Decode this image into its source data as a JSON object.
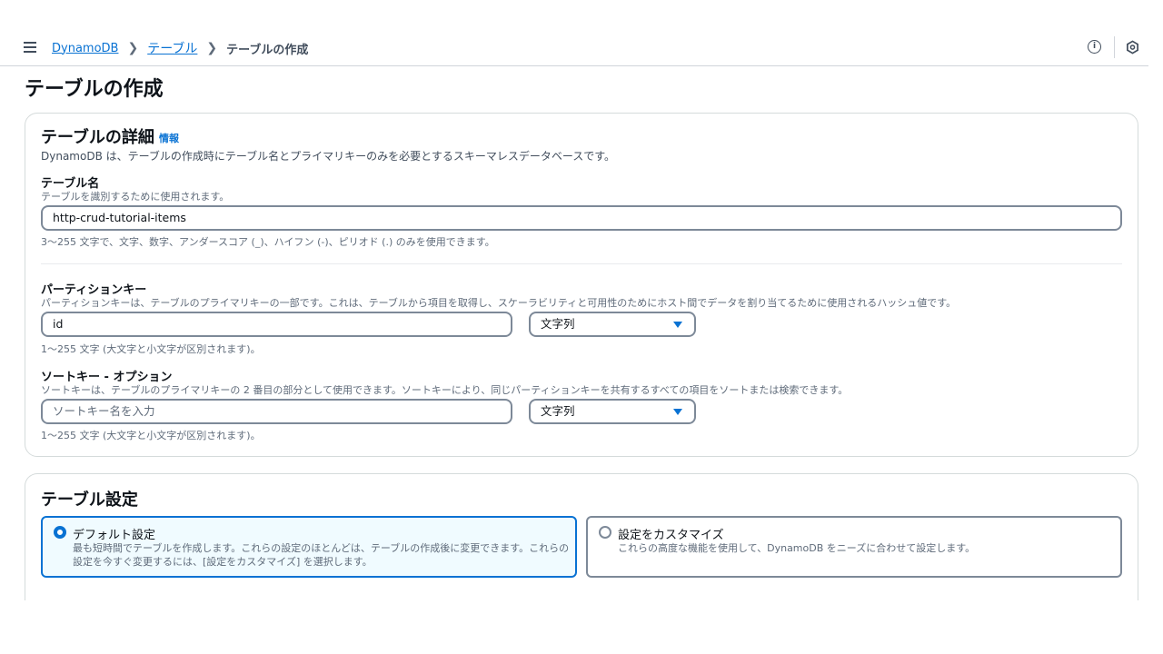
{
  "breadcrumb": {
    "items": [
      "DynamoDB",
      "テーブル"
    ],
    "current": "テーブルの作成"
  },
  "page": {
    "title": "テーブルの作成"
  },
  "details": {
    "title": "テーブルの詳細",
    "info": "情報",
    "description": "DynamoDB は、テーブルの作成時にテーブル名とプライマリキーのみを必要とするスキーマレスデータベースです。",
    "table_name": {
      "label": "テーブル名",
      "description": "テーブルを識別するために使用されます。",
      "value": "http-crud-tutorial-items",
      "constraint": "3～255 文字で、文字、数字、アンダースコア (_)、ハイフン (-)、ピリオド (.) のみを使用できます。"
    },
    "partition_key": {
      "label": "パーティションキー",
      "description": "パーティションキーは、テーブルのプライマリキーの一部です。これは、テーブルから項目を取得し、スケーラビリティと可用性のためにホスト間でデータを割り当てるために使用されるハッシュ値です。",
      "value": "id",
      "type": "文字列",
      "constraint": "1～255 文字 (大文字と小文字が区別されます)。"
    },
    "sort_key": {
      "label": "ソートキー - オプション",
      "description": "ソートキーは、テーブルのプライマリキーの 2 番目の部分として使用できます。ソートキーにより、同じパーティションキーを共有するすべての項目をソートまたは検索できます。",
      "placeholder": "ソートキー名を入力",
      "type": "文字列",
      "constraint": "1～255 文字 (大文字と小文字が区別されます)。"
    }
  },
  "settings": {
    "title": "テーブル設定",
    "options": [
      {
        "title": "デフォルト設定",
        "description_line1": "最も短時間でテーブルを作成します。これらの設定のほとんどは、テーブルの作成後に変更できます。これらの",
        "description_line2": "設定を今すぐ変更するには、[設定をカスタマイズ] を選択します。",
        "selected": true
      },
      {
        "title": "設定をカスタマイズ",
        "description_line1": "これらの高度な機能を使用して、DynamoDB をニーズに合わせて設定します。",
        "selected": false
      }
    ]
  },
  "colors": {
    "accent": "#0972d3",
    "selected_bg": "#f0fbff",
    "border": "#7d8998"
  },
  "icons": [
    "menu-icon",
    "chevron-right-icon",
    "info-icon",
    "shield-icon",
    "caret-down-icon"
  ]
}
